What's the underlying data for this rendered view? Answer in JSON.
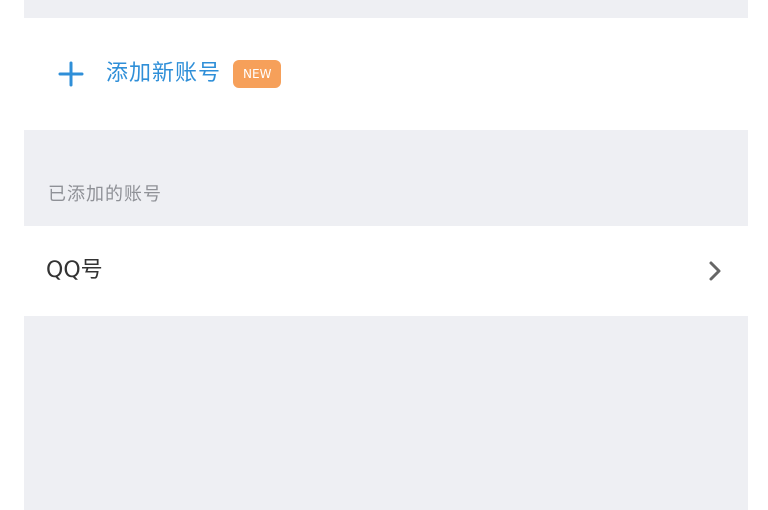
{
  "add_card": {
    "icon": "plus-icon",
    "label": "添加新账号",
    "badge": "NEW"
  },
  "section": {
    "title": "已添加的账号"
  },
  "accounts": [
    {
      "label": "QQ号",
      "icon": "chevron-right-icon"
    }
  ],
  "colors": {
    "accent": "#2f8fd8",
    "badge": "#f6a05a",
    "panel_bg": "#eeeff3",
    "card_bg": "#ffffff",
    "section_text": "#8f9197",
    "item_text": "#333333"
  }
}
